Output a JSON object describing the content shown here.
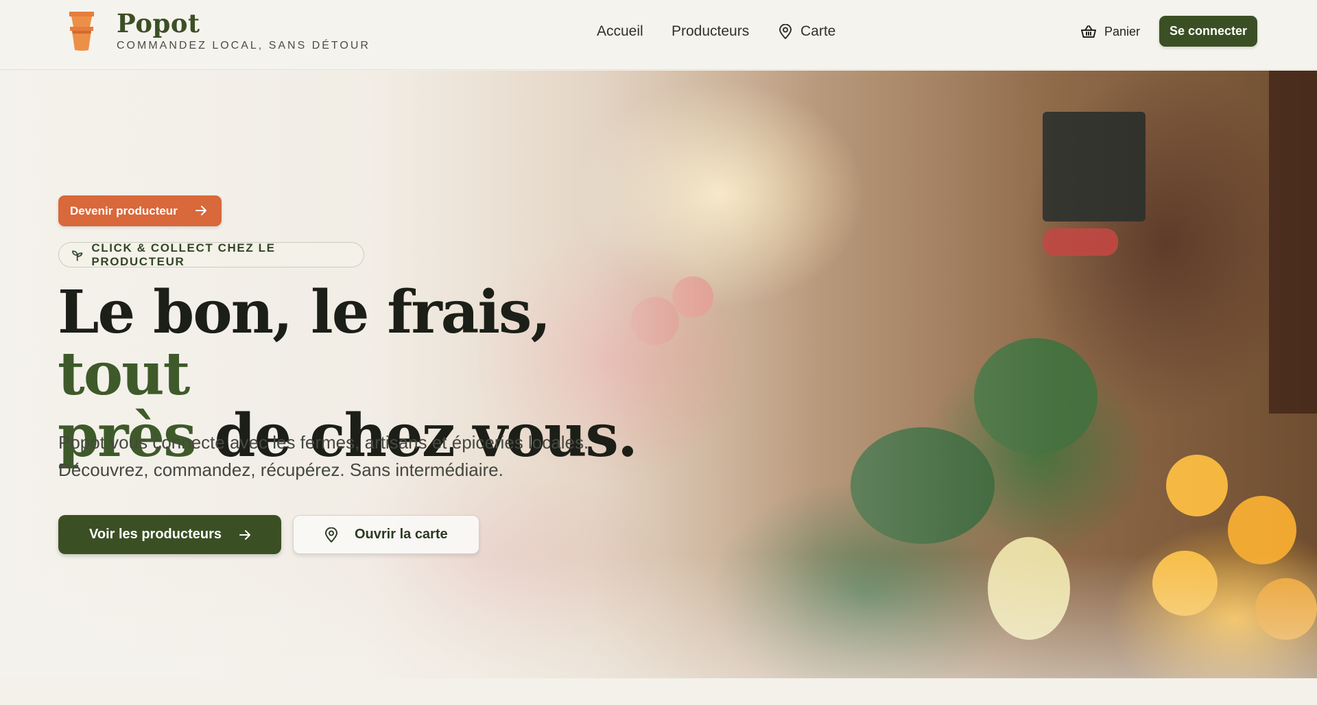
{
  "brand": {
    "name": "Popot",
    "tagline": "COMMANDEZ LOCAL, SANS DÉTOUR",
    "logo_icon": "flower-pot-icon"
  },
  "nav": {
    "items": [
      {
        "label": "Accueil"
      },
      {
        "label": "Producteurs"
      },
      {
        "label": "Carte",
        "icon": "map-pin-icon"
      }
    ]
  },
  "header_actions": {
    "cart_label": "Panier",
    "cart_icon": "basket-icon",
    "login_label": "Se connecter"
  },
  "hero": {
    "become_producer_label": "Devenir producteur",
    "badge_label": "CLICK & COLLECT CHEZ LE PRODUCTEUR",
    "badge_icon": "sprout-icon",
    "headline_part1": "Le bon, le frais, ",
    "headline_accent1": "tout",
    "headline_accent2": "près",
    "headline_part2": " de chez vous.",
    "subtitle_line1": "Popot vous connecte avec les fermes, artisans et épiceries locales.",
    "subtitle_line2": "Découvrez, commandez, récupérez. Sans intermédiaire.",
    "primary_cta": "Voir les producteurs",
    "secondary_cta": "Ouvrir la carte",
    "background_image": "market-produce-stall"
  },
  "colors": {
    "primary_green": "#3b4f24",
    "accent_orange": "#d9683b",
    "accent_text_green": "#3f5a2a",
    "page_background": "#f4f1ea"
  }
}
